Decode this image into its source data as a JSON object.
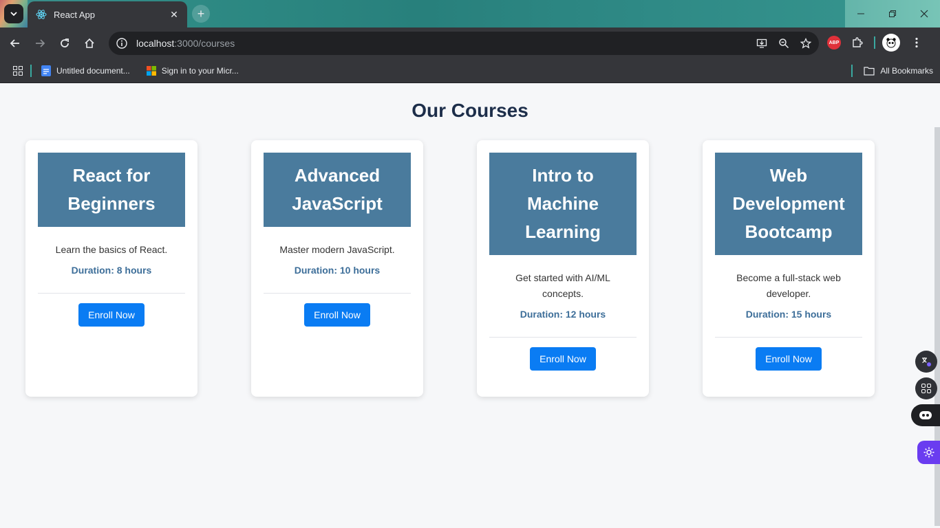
{
  "browser": {
    "tab_title": "React App",
    "url_host": "localhost",
    "url_path": ":3000/courses",
    "bookmarks": [
      {
        "label": "Untitled document..."
      },
      {
        "label": "Sign in to your Micr..."
      }
    ],
    "all_bookmarks_label": "All Bookmarks",
    "abp_label": "ABP"
  },
  "page": {
    "title": "Our Courses",
    "courses": [
      {
        "title": "React for Beginners",
        "description": "Learn the basics of React.",
        "duration": "Duration: 8 hours",
        "button": "Enroll Now"
      },
      {
        "title": "Advanced JavaScript",
        "description": "Master modern JavaScript.",
        "duration": "Duration: 10 hours",
        "button": "Enroll Now"
      },
      {
        "title": "Intro to Machine Learning",
        "description": "Get started with AI/ML concepts.",
        "duration": "Duration: 12 hours",
        "button": "Enroll Now"
      },
      {
        "title": "Web Development Bootcamp",
        "description": "Become a full-stack web developer.",
        "duration": "Duration: 15 hours",
        "button": "Enroll Now"
      }
    ]
  },
  "colors": {
    "card_header": "#4a7b9d",
    "button": "#0a7cf3",
    "title": "#1d2e4a",
    "duration": "#3d6e99"
  }
}
